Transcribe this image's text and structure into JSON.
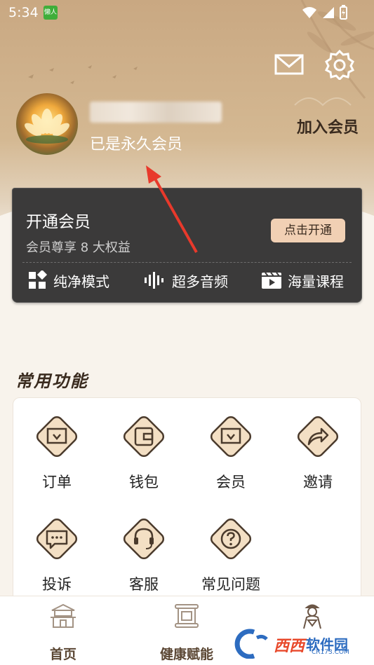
{
  "status_bar": {
    "time": "5:34",
    "notif_app": "懒人"
  },
  "profile": {
    "member_status": "已是永久会员",
    "join_label": "加入会员"
  },
  "vip_card": {
    "title": "开通会员",
    "subtitle": "会员尊享 8 大权益",
    "button": "点击开通",
    "features": [
      {
        "label": "纯净模式",
        "icon": "grid-icon"
      },
      {
        "label": "超多音频",
        "icon": "audio-wave-icon"
      },
      {
        "label": "海量课程",
        "icon": "video-icon"
      }
    ]
  },
  "common_functions": {
    "title": "常用功能",
    "items": [
      {
        "label": "订单",
        "icon": "order-icon"
      },
      {
        "label": "钱包",
        "icon": "wallet-icon"
      },
      {
        "label": "会员",
        "icon": "member-icon"
      },
      {
        "label": "邀请",
        "icon": "share-icon"
      },
      {
        "label": "投诉",
        "icon": "complaint-icon"
      },
      {
        "label": "客服",
        "icon": "headset-icon"
      },
      {
        "label": "常见问题",
        "icon": "question-icon"
      }
    ]
  },
  "bottom_nav": [
    {
      "label": "首页",
      "icon": "temple-icon"
    },
    {
      "label": "健康赋能",
      "icon": "scroll-icon"
    },
    {
      "label": "",
      "icon": "person-icon"
    }
  ],
  "watermark": {
    "brand": "西西",
    "brand2": "软件园",
    "domain": "CR173.COM"
  },
  "colors": {
    "accent": "#f1d0b4",
    "card_dark": "#3b3a3a",
    "hero": "#c9a882"
  }
}
